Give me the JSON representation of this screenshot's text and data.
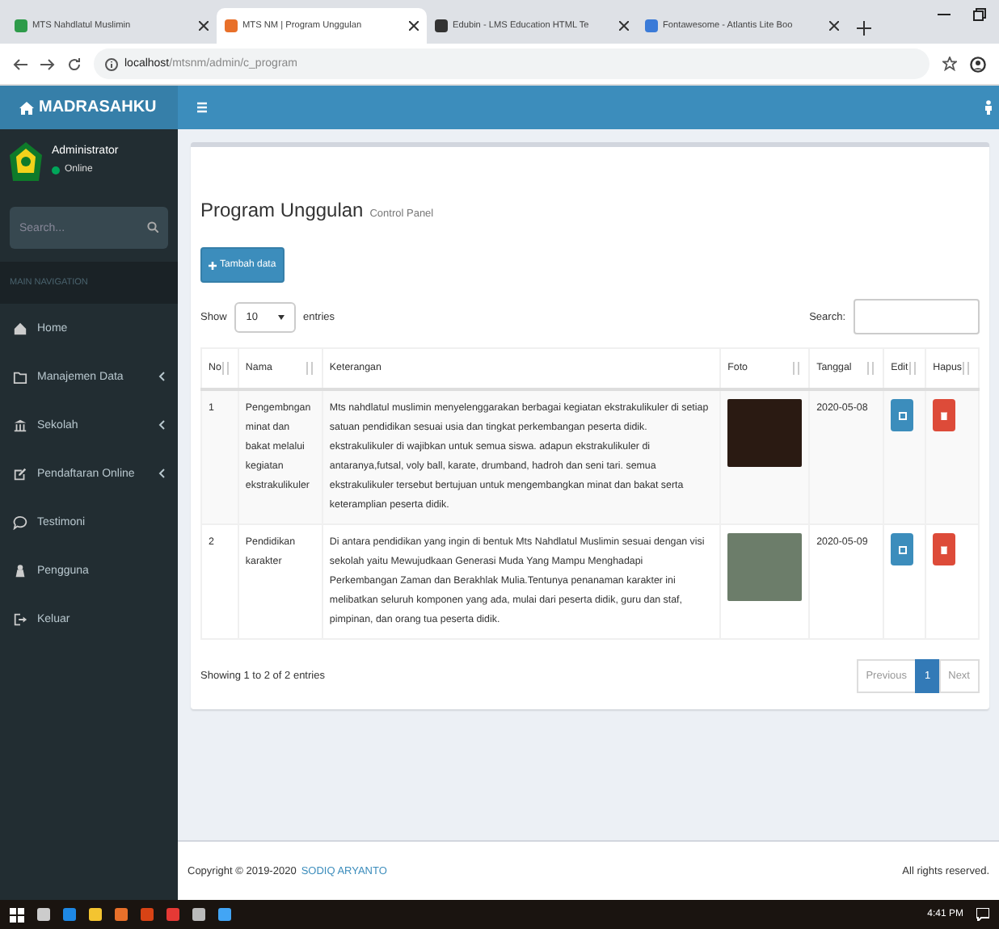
{
  "browser": {
    "tabs": [
      {
        "title": "MTS Nahdlatul Muslimin",
        "selected": false
      },
      {
        "title": "MTS NM | Program Unggulan",
        "selected": true
      },
      {
        "title": "Edubin - LMS Education HTML Te",
        "selected": false
      },
      {
        "title": "Fontawesome - Atlantis Lite Boo",
        "selected": false
      }
    ],
    "address": {
      "host": "localhost",
      "path": "/mtsnm/admin/c_program"
    }
  },
  "header": {
    "brand": "MADRASAHKU"
  },
  "sidebar": {
    "user": {
      "name": "Administrator",
      "status": "Online"
    },
    "search": {
      "placeholder": "Search..."
    },
    "section": "MAIN NAVIGATION",
    "items": [
      {
        "label": "Home",
        "has_submenu": false
      },
      {
        "label": "Manajemen Data",
        "has_submenu": true
      },
      {
        "label": "Sekolah",
        "has_submenu": true
      },
      {
        "label": "Pendaftaran Online",
        "has_submenu": true
      },
      {
        "label": "Testimoni",
        "has_submenu": false
      },
      {
        "label": "Pengguna",
        "has_submenu": false
      },
      {
        "label": "Keluar",
        "has_submenu": false
      }
    ]
  },
  "page": {
    "title": "Program Unggulan",
    "subtitle": "Control Panel",
    "add_button": "Tambah data",
    "length": {
      "prefix": "Show",
      "value": "10",
      "suffix": "entries"
    },
    "search_label": "Search:",
    "table": {
      "columns": [
        "No",
        "Nama",
        "Keterangan",
        "Foto",
        "Tanggal",
        "Edit",
        "Hapus"
      ],
      "rows": [
        {
          "no": "1",
          "nama": "Pengembngan minat dan bakat melalui kegiatan ekstrakulikuler",
          "keterangan": "Mts nahdlatul muslimin menyelenggarakan berbagai kegiatan ekstrakulikuler di setiap satuan pendidikan sesuai usia dan tingkat perkembangan peserta didik. ekstrakulikuler di wajibkan untuk semua siswa. adapun ekstrakulikuler di antaranya,futsal, voly ball, karate, drumband, hadroh dan seni tari. semua ekstrakulikuler tersebut bertujuan untuk mengembangkan minat dan bakat serta keteramplian peserta didik.",
          "tanggal": "2020-05-08"
        },
        {
          "no": "2",
          "nama": "Pendidikan karakter",
          "keterangan": "Di antara pendidikan yang ingin di bentuk Mts Nahdlatul Muslimin sesuai dengan visi sekolah yaitu Mewujudkaan Generasi Muda Yang Mampu Menghadapi Perkembangan Zaman dan Berakhlak Mulia.Tentunya penanaman karakter ini melibatkan seluruh komponen yang ada, mulai dari peserta didik, guru dan staf, pimpinan, dan orang tua peserta didik.",
          "tanggal": "2020-05-09"
        }
      ]
    },
    "info": "Showing 1 to 2 of 2 entries",
    "pagination": [
      {
        "label": "Previous",
        "selected": false
      },
      {
        "label": "1",
        "selected": true
      },
      {
        "label": "Next",
        "selected": false
      }
    ]
  },
  "footer": {
    "copyright": "Copyright © 2019-2020",
    "author": "SODIQ ARYANTO",
    "rights": "All rights reserved."
  },
  "taskbar": {
    "time": "4:41 PM"
  }
}
